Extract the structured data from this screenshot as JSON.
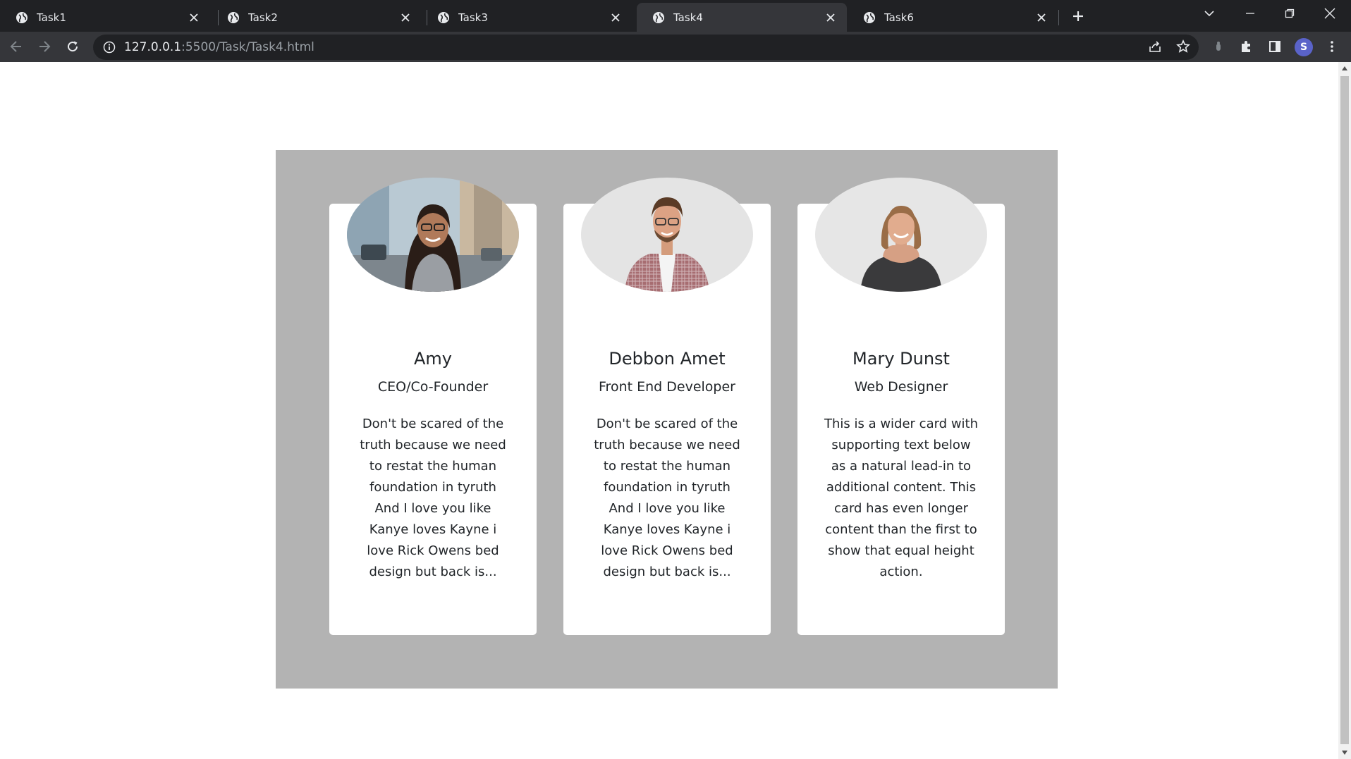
{
  "browser": {
    "tabs": [
      {
        "title": "Task1",
        "active": false
      },
      {
        "title": "Task2",
        "active": false
      },
      {
        "title": "Task3",
        "active": false
      },
      {
        "title": "Task4",
        "active": true
      },
      {
        "title": "Task6",
        "active": false
      }
    ],
    "url_host": "127.0.0.1",
    "url_rest": ":5500/Task/Task4.html",
    "profile_initial": "S",
    "colors": {
      "frame": "#202124",
      "toolbar": "#35363a",
      "avatar": "#5a63c9"
    }
  },
  "page": {
    "panel_color": "#b3b3b3",
    "cards": [
      {
        "name": "Amy",
        "role": "CEO/Co-Founder",
        "text": "Don't be scared of the truth because we need to restat the human foundation in tyruth And I love you like Kanye loves Kayne i love Rick Owens bed design but back is...",
        "photo": "woman-glasses-street-photo"
      },
      {
        "name": "Debbon Amet",
        "role": "Front End Developer",
        "text": "Don't be scared of the truth because we need to restat the human foundation in tyruth And I love you like Kanye loves Kayne i love Rick Owens bed design but back is...",
        "photo": "man-plaid-shirt-photo"
      },
      {
        "name": "Mary Dunst",
        "role": "Web Designer",
        "text": "This is a wider card with supporting text below as a natural lead-in to additional content. This card has even longer content than the first to show that equal height action.",
        "photo": "woman-black-tee-photo"
      }
    ]
  }
}
